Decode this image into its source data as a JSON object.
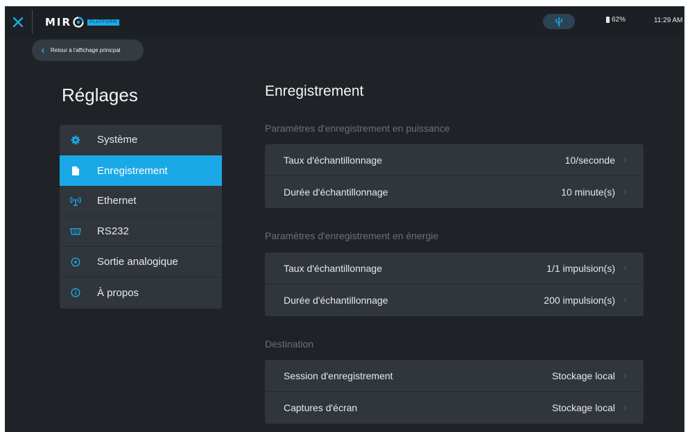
{
  "header": {
    "logo_text": "MIR",
    "logo_sub": "PLATFORM",
    "battery": "62%",
    "time": "11:29 AM"
  },
  "back_label": "Retour à l'affichage prinicpal",
  "page_title": "Réglages",
  "sidebar": {
    "items": [
      {
        "label": "Système",
        "icon": "gear-icon"
      },
      {
        "label": "Enregistrement",
        "icon": "document-icon"
      },
      {
        "label": "Ethernet",
        "icon": "antenna-icon"
      },
      {
        "label": "RS232",
        "icon": "serial-port-icon"
      },
      {
        "label": "Sortie analogique",
        "icon": "target-icon"
      },
      {
        "label": "À propos",
        "icon": "info-icon"
      }
    ],
    "active_index": 1
  },
  "main": {
    "title": "Enregistrement",
    "groups": [
      {
        "title": "Paramètres d'enregistrement en puissance",
        "rows": [
          {
            "label": "Taux d'échantillonnage",
            "value": "10/seconde"
          },
          {
            "label": "Durée d'échantillonnage",
            "value": "10 minute(s)"
          }
        ]
      },
      {
        "title": "Paramètres d'enregistrement en énergie",
        "rows": [
          {
            "label": "Taux d'échantillonnage",
            "value": "1/1 impulsion(s)"
          },
          {
            "label": "Durée d'échantillonnage",
            "value": "200 impulsion(s)"
          }
        ]
      },
      {
        "title": "Destination",
        "rows": [
          {
            "label": "Session d'enregistrement",
            "value": "Stockage local"
          },
          {
            "label": "Captures d'écran",
            "value": "Stockage local"
          }
        ]
      }
    ]
  },
  "colors": {
    "accent": "#1aa9e6",
    "background": "#1f2327",
    "panel": "#30363c"
  }
}
